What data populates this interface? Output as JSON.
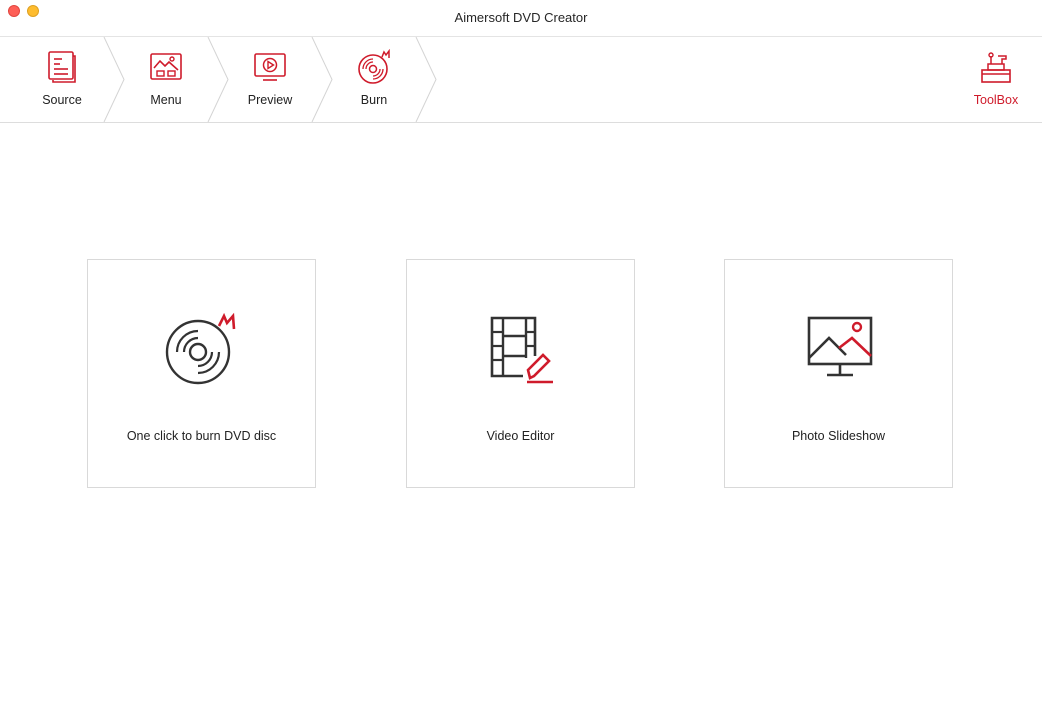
{
  "window": {
    "title": "Aimersoft DVD Creator"
  },
  "toolbar": {
    "steps": [
      {
        "label": "Source",
        "icon": "document-icon"
      },
      {
        "label": "Menu",
        "icon": "menu-template-icon"
      },
      {
        "label": "Preview",
        "icon": "preview-play-icon"
      },
      {
        "label": "Burn",
        "icon": "burn-disc-icon"
      }
    ],
    "toolbox": {
      "label": "ToolBox",
      "icon": "toolbox-icon"
    }
  },
  "cards": [
    {
      "label": "One click to burn DVD disc",
      "icon": "burn-disc-icon"
    },
    {
      "label": "Video Editor",
      "icon": "film-edit-icon"
    },
    {
      "label": "Photo Slideshow",
      "icon": "photo-monitor-icon"
    }
  ],
  "colors": {
    "accent": "#cf1b2b",
    "icon_dark": "#333333",
    "border": "#d9d9d9"
  }
}
